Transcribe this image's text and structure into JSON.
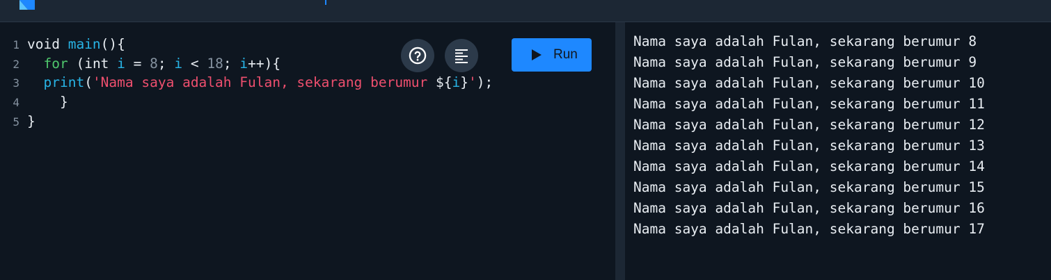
{
  "editor": {
    "lines": [
      {
        "number": "1",
        "indent": "",
        "tokens": [
          {
            "cls": "tok-plain",
            "text": "void "
          },
          {
            "cls": "tok-fn",
            "text": "main"
          },
          {
            "cls": "tok-plain",
            "text": "(){"
          }
        ]
      },
      {
        "number": "2",
        "indent": "  ",
        "tokens": [
          {
            "cls": "tok-kw",
            "text": "for"
          },
          {
            "cls": "tok-plain",
            "text": " (int "
          },
          {
            "cls": "tok-var",
            "text": "i"
          },
          {
            "cls": "tok-plain",
            "text": " = "
          },
          {
            "cls": "tok-num",
            "text": "8"
          },
          {
            "cls": "tok-plain",
            "text": "; "
          },
          {
            "cls": "tok-var",
            "text": "i"
          },
          {
            "cls": "tok-plain",
            "text": " < "
          },
          {
            "cls": "tok-num",
            "text": "18"
          },
          {
            "cls": "tok-plain",
            "text": "; "
          },
          {
            "cls": "tok-var",
            "text": "i"
          },
          {
            "cls": "tok-plain",
            "text": "++){"
          }
        ]
      },
      {
        "number": "3",
        "indent": "  ",
        "tokens": [
          {
            "cls": "tok-fn",
            "text": "print"
          },
          {
            "cls": "tok-plain",
            "text": "("
          },
          {
            "cls": "tok-str",
            "text": "'Nama saya adalah Fulan, sekarang berumur "
          },
          {
            "cls": "tok-plain",
            "text": "${"
          },
          {
            "cls": "tok-var",
            "text": "i"
          },
          {
            "cls": "tok-plain",
            "text": "}"
          },
          {
            "cls": "tok-str",
            "text": "'"
          },
          {
            "cls": "tok-plain",
            "text": ");"
          }
        ]
      },
      {
        "number": "4",
        "indent": "    ",
        "tokens": [
          {
            "cls": "tok-plain",
            "text": "}"
          }
        ]
      },
      {
        "number": "5",
        "indent": "",
        "tokens": [
          {
            "cls": "tok-plain",
            "text": "}"
          }
        ]
      }
    ]
  },
  "toolbar": {
    "help_icon": "help-circle-icon",
    "format_icon": "format-align-icon",
    "run_icon": "play-icon",
    "run_label": "Run"
  },
  "console": {
    "output_lines": [
      "Nama saya adalah Fulan, sekarang berumur 8",
      "Nama saya adalah Fulan, sekarang berumur 9",
      "Nama saya adalah Fulan, sekarang berumur 10",
      "Nama saya adalah Fulan, sekarang berumur 11",
      "Nama saya adalah Fulan, sekarang berumur 12",
      "Nama saya adalah Fulan, sekarang berumur 13",
      "Nama saya adalah Fulan, sekarang berumur 14",
      "Nama saya adalah Fulan, sekarang berumur 15",
      "Nama saya adalah Fulan, sekarang berumur 16",
      "Nama saya adalah Fulan, sekarang berumur 17"
    ]
  },
  "colors": {
    "background": "#0e1620",
    "topbar": "#1c2734",
    "accent": "#1e88ff",
    "keyword": "#4fc86d",
    "function": "#28b4e6",
    "string": "#ee4f6e",
    "number": "#8592a0"
  }
}
